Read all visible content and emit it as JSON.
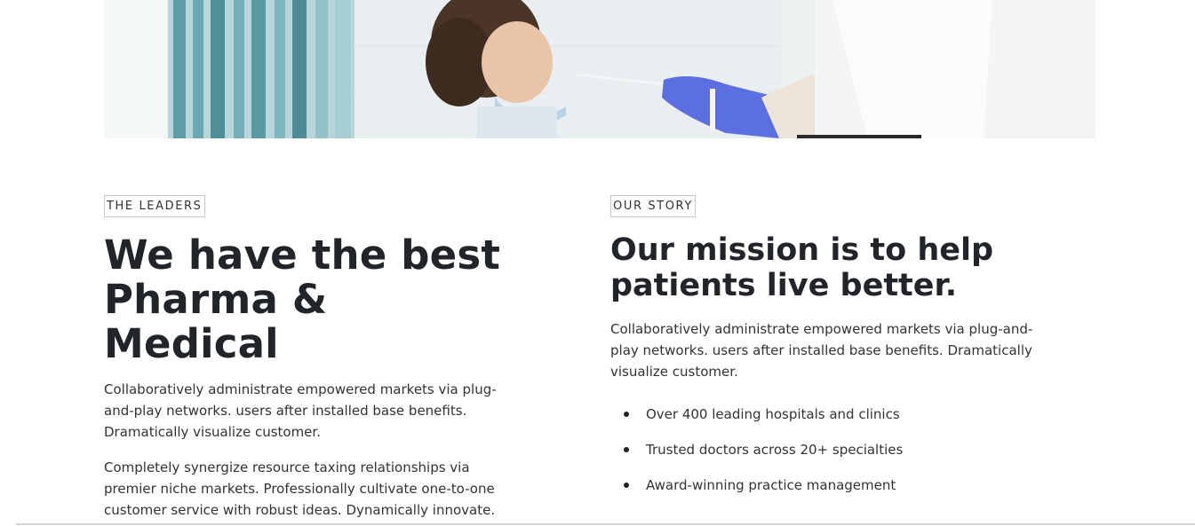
{
  "hero": {
    "image_description_icon": "medical-test-photo"
  },
  "leaders": {
    "eyebrow": "THE LEADERS",
    "heading_line1": "We have the best",
    "heading_line2": "Pharma & Medical",
    "paragraph1": "Collaboratively administrate empowered markets via plug-and-play networks. users after installed base benefits. Dramatically visualize customer.",
    "paragraph2": "Completely synergize resource taxing relationships via premier niche markets. Professionally cultivate one-to-one customer service with robust ideas. Dynamically innovate."
  },
  "story": {
    "eyebrow": "OUR STORY",
    "heading": "Our mission is to help patients live better.",
    "paragraph": "Collaboratively administrate empowered markets via plug-and-play networks. users after installed base benefits. Dramatically visualize customer.",
    "bullets": [
      "Over 400 leading hospitals and clinics",
      "Trusted doctors across 20+ specialties",
      "Award-winning practice management"
    ]
  },
  "colors": {
    "text_dark": "#212529",
    "text_body": "#333333",
    "border": "#c9c9c9",
    "glove_blue": "#5b6fe0",
    "curtain_teal": "#5fa3ad"
  }
}
